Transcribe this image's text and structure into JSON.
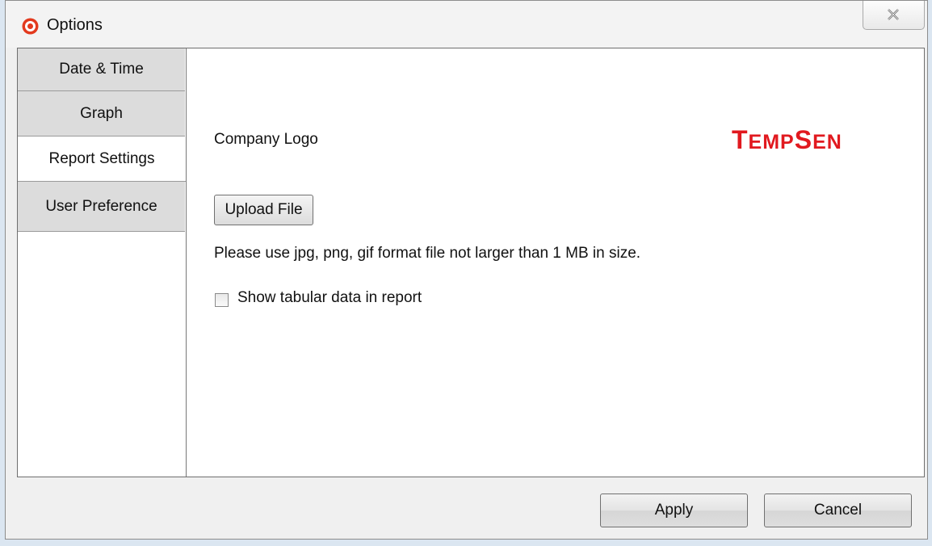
{
  "window": {
    "title": "Options",
    "app_icon": "app-logo-icon",
    "close_icon": "close-icon"
  },
  "tabs": [
    {
      "label": "Date & Time",
      "active": false
    },
    {
      "label": "Graph",
      "active": false
    },
    {
      "label": "Report Settings",
      "active": true
    },
    {
      "label": "User Preference",
      "active": false
    }
  ],
  "report_settings": {
    "company_logo_label": "Company Logo",
    "brand_logo_text": "TempSen",
    "brand_color": "#e1191f",
    "upload_button": "Upload File",
    "hint": "Please use jpg, png, gif format file not larger than 1 MB in size.",
    "show_tabular_label": "Show tabular data in report",
    "show_tabular_checked": false
  },
  "footer": {
    "apply_label": "Apply",
    "cancel_label": "Cancel"
  }
}
